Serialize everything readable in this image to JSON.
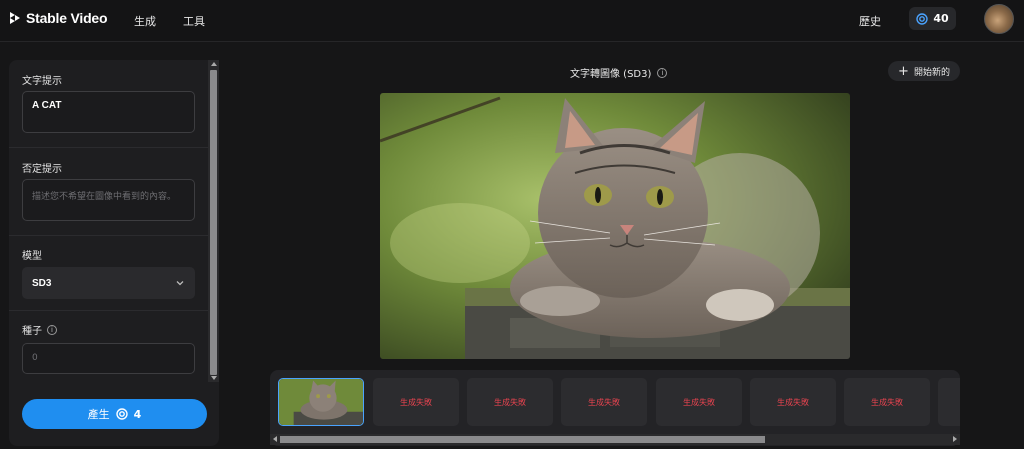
{
  "app": {
    "name": "Stable Video"
  },
  "nav": {
    "generate": "生成",
    "tools": "工具",
    "history": "歷史"
  },
  "credits": {
    "count": "40"
  },
  "form": {
    "prompt_label": "文字提示",
    "prompt_value": "A CAT",
    "negative_label": "否定提示",
    "negative_placeholder": "描述您不希望在圖像中看到的內容。",
    "model_label": "模型",
    "model_value": "SD3",
    "seed_label": "種子",
    "seed_placeholder": "0"
  },
  "generate_button": {
    "label": "產生",
    "cost": "4"
  },
  "canvas": {
    "title": "文字轉圖像 (SD3)",
    "new_label": "開始新的"
  },
  "thumbnails": {
    "failed_label": "生成失敗"
  },
  "colors": {
    "accent": "#1f8ef0",
    "error": "#e6434f",
    "background": "#161617"
  }
}
